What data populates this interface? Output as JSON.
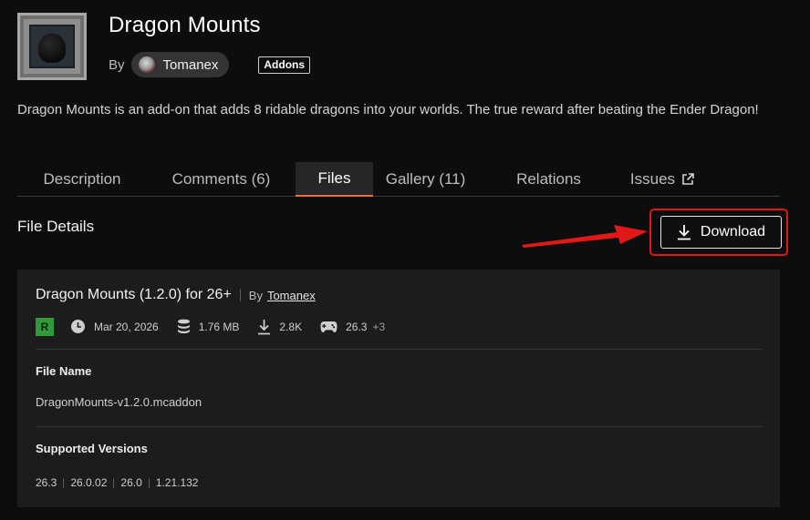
{
  "project": {
    "title": "Dragon Mounts",
    "by_label": "By",
    "author": "Tomanex",
    "category": "Addons",
    "summary": "Dragon Mounts is an add-on that adds 8 ridable dragons into your worlds. The true reward after beating the Ender Dragon!"
  },
  "tabs": [
    {
      "label": "Description"
    },
    {
      "label": "Comments (6)"
    },
    {
      "label": "Files"
    },
    {
      "label": "Gallery (11)"
    },
    {
      "label": "Relations"
    },
    {
      "label": "Issues"
    }
  ],
  "active_tab": "Files",
  "file_details": {
    "section_title": "File Details",
    "download_label": "Download",
    "display_name": "Dragon Mounts (1.2.0) for 26+",
    "by_label": "By",
    "uploader": "Tomanex",
    "release_type": "R",
    "date": "Mar 20, 2026",
    "size": "1.76 MB",
    "downloads": "2.8K",
    "game_version": "26.3",
    "more_versions": "+3",
    "file_name_label": "File Name",
    "file_name": "DragonMounts-v1.2.0.mcaddon",
    "supported_label": "Supported Versions",
    "supported_versions": [
      "26.3",
      "26.0.02",
      "26.0",
      "1.21.132"
    ]
  },
  "colors": {
    "active_tab_underline": "#f06a3c",
    "release_badge": "#2f9a3a",
    "annotation": "#e01818"
  }
}
